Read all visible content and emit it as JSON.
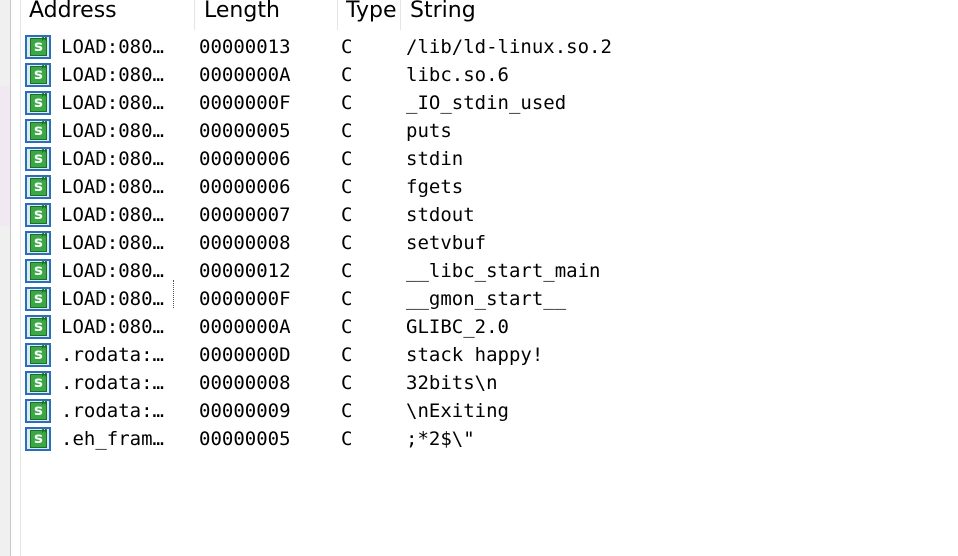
{
  "columns": {
    "address": "Address",
    "length": "Length",
    "type": "Type",
    "string": "String"
  },
  "icon": "string-literal-icon",
  "rows": [
    {
      "address": "LOAD:080…",
      "length": "00000013",
      "type": "C",
      "string": "/lib/ld-linux.so.2"
    },
    {
      "address": "LOAD:080…",
      "length": "0000000A",
      "type": "C",
      "string": "libc.so.6"
    },
    {
      "address": "LOAD:080…",
      "length": "0000000F",
      "type": "C",
      "string": "_IO_stdin_used"
    },
    {
      "address": "LOAD:080…",
      "length": "00000005",
      "type": "C",
      "string": "puts"
    },
    {
      "address": "LOAD:080…",
      "length": "00000006",
      "type": "C",
      "string": "stdin"
    },
    {
      "address": "LOAD:080…",
      "length": "00000006",
      "type": "C",
      "string": "fgets"
    },
    {
      "address": "LOAD:080…",
      "length": "00000007",
      "type": "C",
      "string": "stdout"
    },
    {
      "address": "LOAD:080…",
      "length": "00000008",
      "type": "C",
      "string": "setvbuf"
    },
    {
      "address": "LOAD:080…",
      "length": "00000012",
      "type": "C",
      "string": "__libc_start_main"
    },
    {
      "address": "LOAD:080…",
      "length": "0000000F",
      "type": "C",
      "string": "__gmon_start__"
    },
    {
      "address": "LOAD:080…",
      "length": "0000000A",
      "type": "C",
      "string": "GLIBC_2.0"
    },
    {
      "address": ".rodata:…",
      "length": "0000000D",
      "type": "C",
      "string": "stack happy!"
    },
    {
      "address": ".rodata:…",
      "length": "00000008",
      "type": "C",
      "string": "32bits\\n"
    },
    {
      "address": ".rodata:…",
      "length": "00000009",
      "type": "C",
      "string": "\\nExiting"
    },
    {
      "address": ".eh_fram…",
      "length": "00000005",
      "type": "C",
      "string": ";*2$\\\""
    }
  ]
}
